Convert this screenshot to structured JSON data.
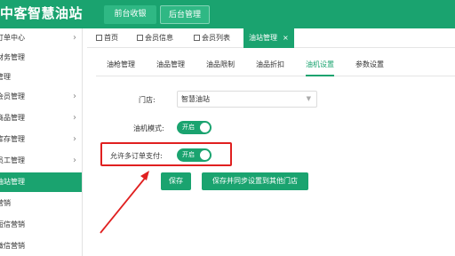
{
  "header": {
    "logo_text": "中客智慧油站",
    "nav": [
      {
        "label": "前台收银"
      },
      {
        "label": "后台管理"
      }
    ]
  },
  "sidebar": {
    "items": [
      {
        "label": "订单中心",
        "has_arrow": true
      },
      {
        "label": "财务管理",
        "has_arrow": false
      },
      {
        "label": "管理",
        "has_arrow": false
      },
      {
        "label": "会员管理",
        "has_arrow": true
      },
      {
        "label": "商品管理",
        "has_arrow": true
      },
      {
        "label": "库存管理",
        "has_arrow": true
      },
      {
        "label": "员工管理",
        "has_arrow": true
      },
      {
        "label": "油站管理",
        "has_arrow": false,
        "active": true
      },
      {
        "label": "营销",
        "has_arrow": false
      },
      {
        "label": "短信营销",
        "has_arrow": false
      },
      {
        "label": "微信营销",
        "has_arrow": false
      }
    ]
  },
  "tabs": [
    {
      "label": "首页"
    },
    {
      "label": "会员信息"
    },
    {
      "label": "会员列表"
    },
    {
      "label": "油站管理",
      "active": true,
      "close": "×"
    }
  ],
  "subtabs": [
    {
      "label": "油枪管理"
    },
    {
      "label": "油品管理"
    },
    {
      "label": "油品限制"
    },
    {
      "label": "油品折扣"
    },
    {
      "label": "油机设置",
      "active": true
    },
    {
      "label": "参数设置"
    }
  ],
  "form": {
    "store_label": "门店:",
    "store_value": "智慧油站",
    "machine_mode_label": "油机模式:",
    "machine_mode_switch": "开启",
    "multi_order_label": "允许多订单支付:",
    "multi_order_switch": "开启"
  },
  "actions": {
    "save_label": "保存",
    "sync_label": "保存并同步设置到其他门店"
  },
  "colors": {
    "brand": "#1aa36f",
    "highlight": "#e02020"
  }
}
